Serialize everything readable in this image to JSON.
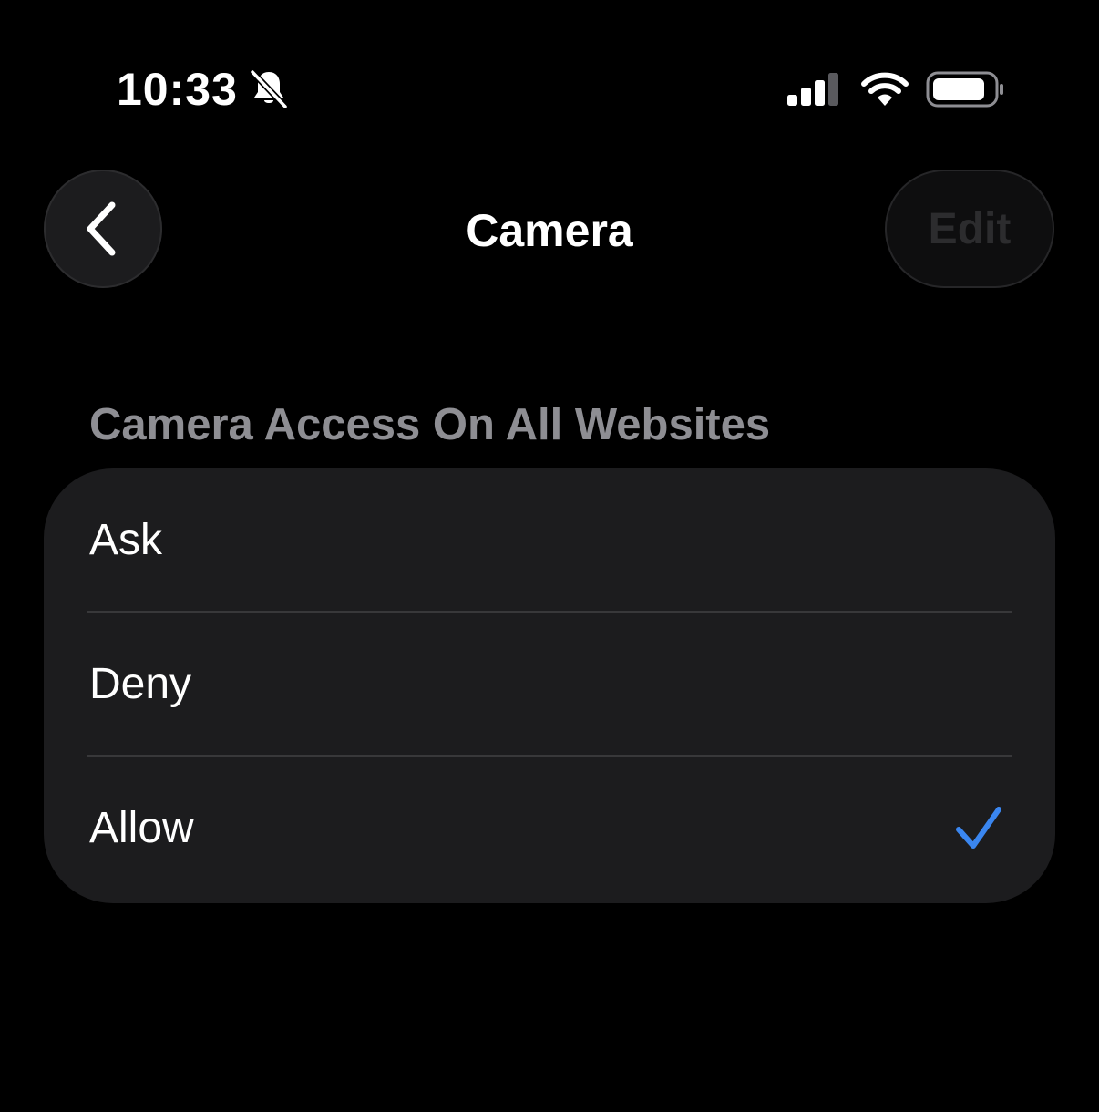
{
  "status_bar": {
    "time": "10:33",
    "icons": [
      "bell-slash-icon",
      "cellular-signal-icon",
      "wifi-icon",
      "battery-icon"
    ]
  },
  "nav": {
    "title": "Camera",
    "back_icon": "chevron-left-icon",
    "edit_label": "Edit"
  },
  "section": {
    "header": "Camera Access On All Websites",
    "options": [
      {
        "label": "Ask",
        "selected": false
      },
      {
        "label": "Deny",
        "selected": false
      },
      {
        "label": "Allow",
        "selected": true
      }
    ]
  },
  "colors": {
    "background": "#000000",
    "group_background": "#1c1c1e",
    "secondary_text": "#8e8e93",
    "accent": "#3a86f0"
  }
}
